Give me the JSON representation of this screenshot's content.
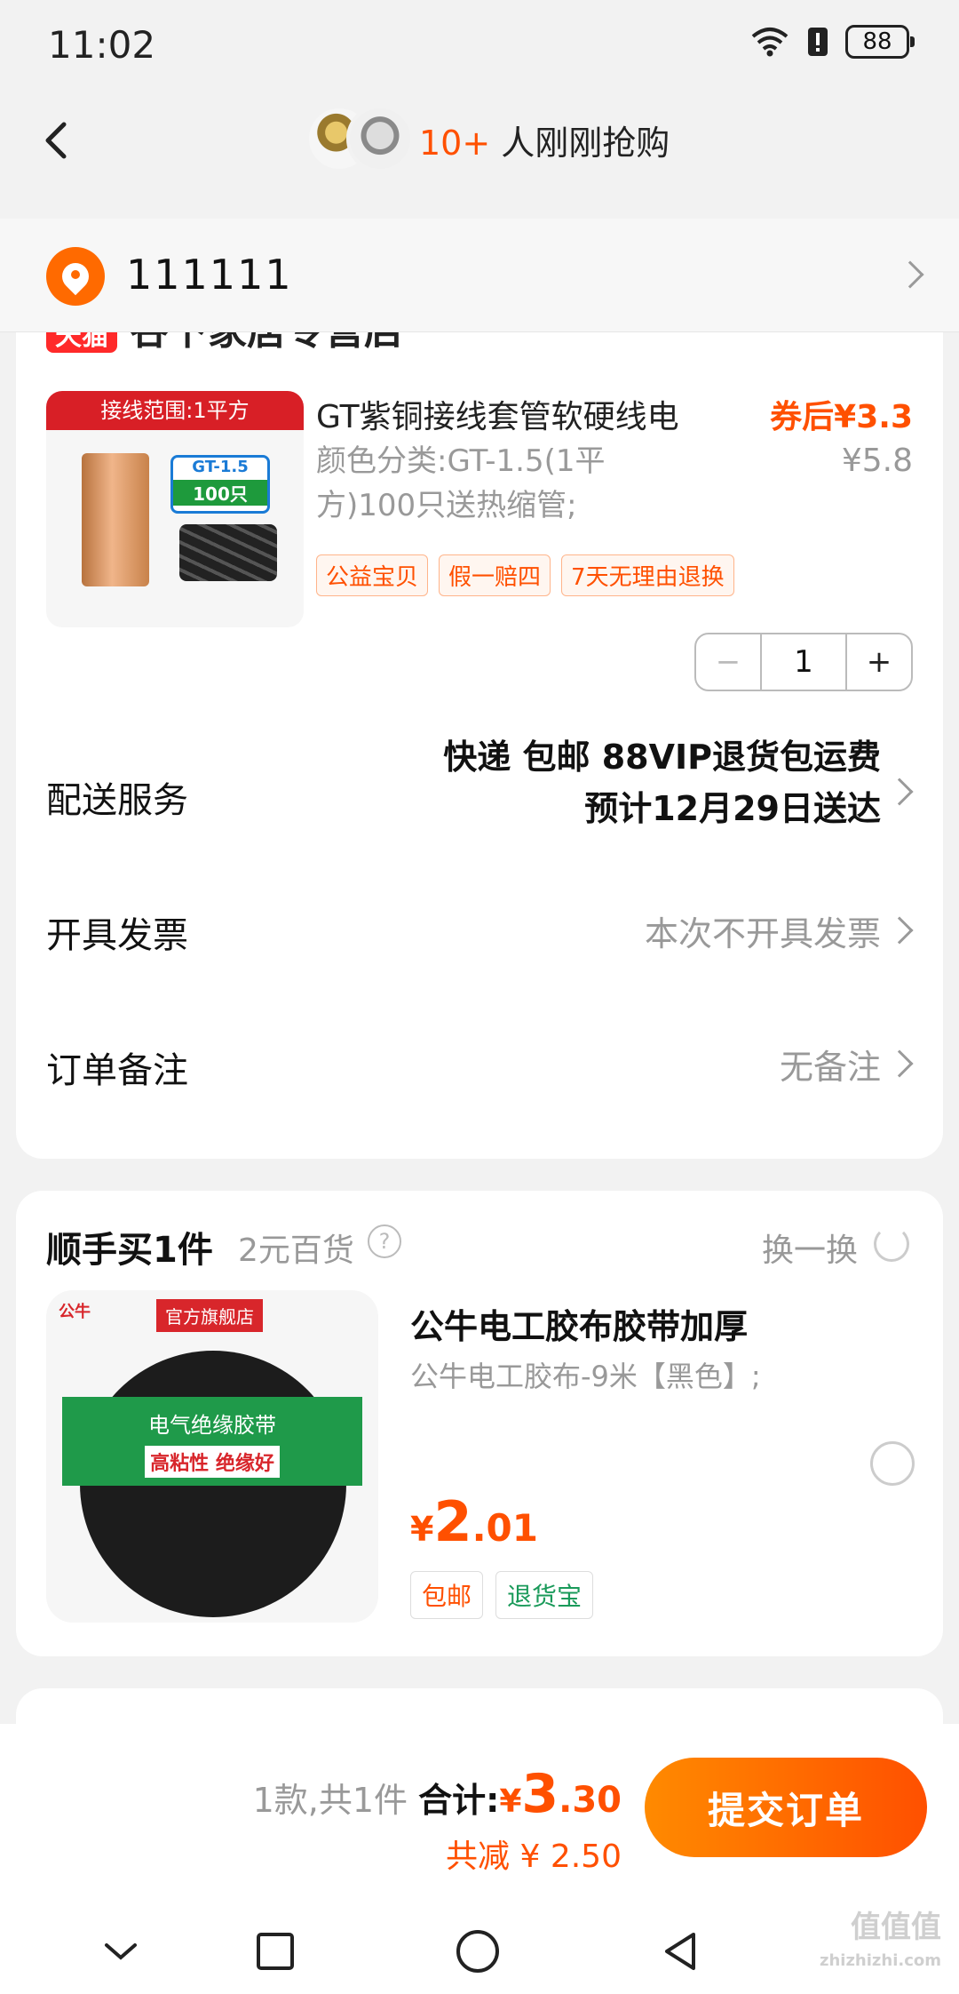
{
  "status": {
    "time": "11:02",
    "battery": "88"
  },
  "header": {
    "grab_count": "10+",
    "grab_text": "人刚刚抢购"
  },
  "address": {
    "text": "111111"
  },
  "shop": {
    "badge": "天猫",
    "name": "谷下家居专营店"
  },
  "product": {
    "image_banner": "接线范围:1平方",
    "image_model": "GT-1.5",
    "image_qty": "100只",
    "title": "GT紫铜接线套管软硬线电",
    "spec": "颜色分类:GT-1.5(1平方)100只送热缩管;",
    "coupon_price": "券后¥3.3",
    "orig_price": "¥5.8",
    "tags": [
      "公益宝贝",
      "假一赔四",
      "7天无理由退换"
    ],
    "quantity": "1",
    "minus": "−",
    "plus": "+"
  },
  "rows": {
    "delivery_label": "配送服务",
    "delivery_line1": "快递 包邮 88VIP退货包运费",
    "delivery_line2": "预计12月29日送达",
    "invoice_label": "开具发票",
    "invoice_value": "本次不开具发票",
    "note_label": "订单备注",
    "note_value": "无备注"
  },
  "addon": {
    "title": "顺手买1件",
    "subtitle": "2元百货",
    "help": "?",
    "swap": "换一换",
    "image_brand": "公牛",
    "image_flag": "官方旗舰店",
    "image_label": "电气绝缘胶带",
    "image_hl": "高粘性 绝缘好",
    "name": "公牛电工胶布胶带加厚",
    "spec": "公牛电工胶布-9米【黑色】;",
    "price_currency": "¥",
    "price_int": "2",
    "price_dec": ".01",
    "tag1": "包邮",
    "tag2": "退货宝"
  },
  "bottom": {
    "count": "1款,共1件",
    "total_label": "合计:",
    "total_currency": "¥",
    "total_int": "3",
    "total_dec": ".30",
    "saved": "共减 ¥ 2.50",
    "submit": "提交订单"
  },
  "watermark": {
    "main": "值值值",
    "sub": "zhizhizhi.com"
  },
  "colors": {
    "accent": "#ff5000",
    "accent_light": "#ff8a00",
    "green": "#1a9a5a"
  }
}
